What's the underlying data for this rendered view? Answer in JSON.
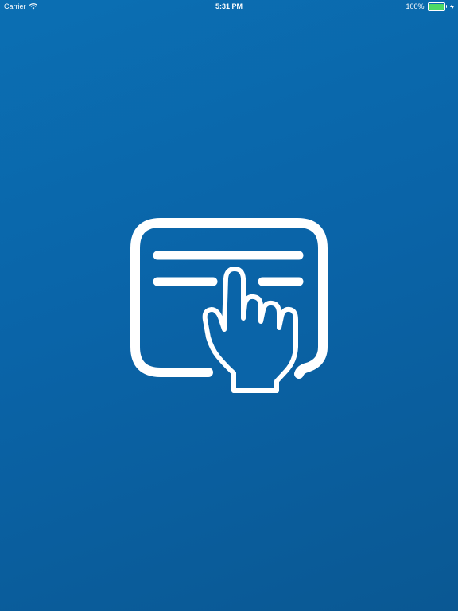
{
  "status_bar": {
    "carrier": "Carrier",
    "time": "5:31 PM",
    "battery_text": "100%",
    "battery_level": 1.0,
    "battery_color": "#4cd964"
  },
  "splash": {
    "background_color": "#0a64a8",
    "logo_icon": "card-tap-hand-icon"
  }
}
